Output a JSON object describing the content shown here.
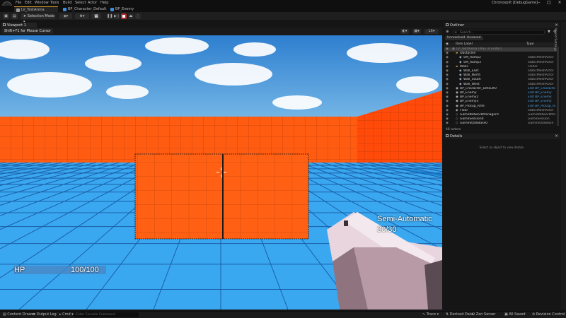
{
  "menubar": {
    "items": [
      "File",
      "Edit",
      "Window",
      "Tools",
      "Build",
      "Select",
      "Actor",
      "Help"
    ],
    "app_title": "Chronosplit [DebugGame]"
  },
  "tabs": [
    {
      "label": "LV_TestArena",
      "color": "#9d9d9d"
    },
    {
      "label": "BP_Character_Default",
      "color": "#3b8fe0"
    },
    {
      "label": "BP_Enemy",
      "color": "#3b8fe0"
    }
  ],
  "toolbar": {
    "mode_label": "Selection Mode",
    "platforms_label": "Platforms",
    "settings_label": "Settings"
  },
  "viewport": {
    "tab_label": "Viewport 1",
    "notice": "Shift+F1 for Mouse Cursor",
    "view_mode": "Lit"
  },
  "hud": {
    "hp_label": "HP",
    "hp_value": "100/100",
    "hp_fraction": 1.0,
    "weapon_mode": "Semi-Automatic",
    "ammo": "30/30"
  },
  "outliner": {
    "title": "Outliner",
    "search_placeholder": "Search...",
    "filters": [
      "Unresolved",
      "Unsaved"
    ],
    "col_label": "Item Label",
    "col_type": "Type",
    "rows": [
      {
        "label": "LV_TestArena (Play in Editor)",
        "type": "",
        "indent": 1,
        "icon": "world-icon",
        "hl": true
      },
      {
        "label": "Obstacles",
        "type": "",
        "indent": 2,
        "icon": "folder-icon",
        "hl": false
      },
      {
        "label": "SM_Ramp2",
        "type": "StaticMeshActor",
        "indent": 3,
        "icon": "mesh-icon",
        "hl": false
      },
      {
        "label": "SM_Ramp3",
        "type": "StaticMeshActor",
        "indent": 3,
        "icon": "mesh-icon",
        "hl": false
      },
      {
        "label": "Walls",
        "type": "Folder",
        "indent": 2,
        "icon": "folder-icon",
        "hl": false
      },
      {
        "label": "Wall_East",
        "type": "StaticMeshActor",
        "indent": 3,
        "icon": "mesh-icon",
        "hl": false
      },
      {
        "label": "Wall_North",
        "type": "StaticMeshActor",
        "indent": 3,
        "icon": "mesh-icon",
        "hl": false
      },
      {
        "label": "Wall_South",
        "type": "StaticMeshActor",
        "indent": 3,
        "icon": "mesh-icon",
        "hl": false
      },
      {
        "label": "Wall_West",
        "type": "StaticMeshActor",
        "indent": 3,
        "icon": "mesh-icon",
        "hl": false
      },
      {
        "label": "BP_Character_Default0",
        "type": "Edit BP_Character_De",
        "indent": 2,
        "icon": "pawn-icon",
        "hl": false,
        "link": true
      },
      {
        "label": "BP_Enemy",
        "type": "Edit BP_Enemy",
        "indent": 2,
        "icon": "pawn-icon",
        "hl": false,
        "link": true
      },
      {
        "label": "BP_Enemy2",
        "type": "Edit BP_Enemy",
        "indent": 2,
        "icon": "pawn-icon",
        "hl": false,
        "link": true
      },
      {
        "label": "BP_Enemy3",
        "type": "Edit BP_Enemy",
        "indent": 2,
        "icon": "pawn-icon",
        "hl": false,
        "link": true
      },
      {
        "label": "BP_Pickup_Rifle",
        "type": "Edit BP_Pickup_Rifle",
        "indent": 2,
        "icon": "pawn-icon",
        "hl": false,
        "link": true
      },
      {
        "label": "Floor",
        "type": "StaticMeshActor",
        "indent": 2,
        "icon": "mesh-icon",
        "hl": false
      },
      {
        "label": "GameNetworkManager0",
        "type": "GameNetworkManager",
        "indent": 2,
        "icon": "actor-icon",
        "hl": false
      },
      {
        "label": "GameSession0",
        "type": "GameSession",
        "indent": 2,
        "icon": "actor-icon",
        "hl": false
      },
      {
        "label": "GameStateBase0",
        "type": "GameStateBase",
        "indent": 2,
        "icon": "actor-icon",
        "hl": false
      }
    ],
    "actor_count": "46 actors"
  },
  "details": {
    "title": "Details",
    "empty_message": "Select an object to view details."
  },
  "side_tab": "World Settings",
  "statusbar": {
    "content_drawer": "Content Drawer",
    "output_log": "Output Log",
    "cmd": "Cmd",
    "cmd_placeholder": "Enter Console Command",
    "trace": "Trace",
    "derived_data": "Derived Data",
    "zen_server": "Zen Server",
    "all_saved": "All Saved",
    "revision_control": "Revision Control"
  },
  "colors": {
    "sky": "#3f8fd8",
    "wall": "#ff5a10",
    "floor": "#33a6f0",
    "accent": "#d39b27",
    "link": "#4a9de0"
  }
}
